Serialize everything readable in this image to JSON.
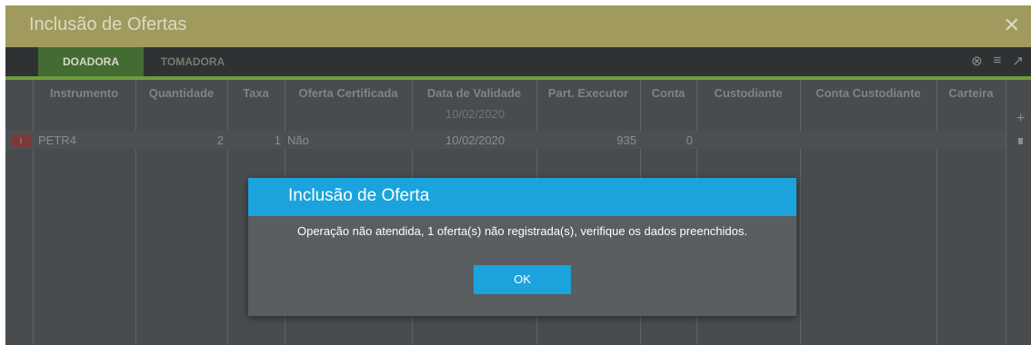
{
  "window": {
    "title": "Inclusão de Ofertas",
    "close_symbol": "✕"
  },
  "tabs": [
    {
      "label": "DOADORA"
    },
    {
      "label": "TOMADORA"
    }
  ],
  "toolbar": {
    "clear_filter_symbol": "⊗",
    "filter_symbol": "≡",
    "expand_symbol": "↗"
  },
  "grid": {
    "columns": [
      "Instrumento",
      "Quantidade",
      "Taxa",
      "Oferta Certificada",
      "Data de Validade",
      "Part. Executor",
      "Conta",
      "Custodiante",
      "Conta Custodiante",
      "Carteira"
    ],
    "default_validity": "10/02/2020",
    "rows": [
      {
        "badge": "i",
        "instrumento": "PETR4",
        "quantidade": "2",
        "taxa": "1",
        "oferta_certificada": "Não",
        "data_validade": "10/02/2020",
        "part_executor": "935",
        "conta": "0",
        "custodiante": "",
        "conta_custodiante": "",
        "carteira": ""
      }
    ],
    "add_symbol": "+"
  },
  "dialog": {
    "title": "Inclusão de Oferta",
    "message": "Operação não atendida, 1 oferta(s) não registrada(s), verifique os dados preenchidos.",
    "ok_label": "OK"
  },
  "colors": {
    "title_bar": "#a09a5e",
    "active_tab": "#446c32",
    "tab_underline": "#6f9c3c",
    "dialog_header": "#1ba3dd",
    "ok_button": "#1ba3dd"
  }
}
